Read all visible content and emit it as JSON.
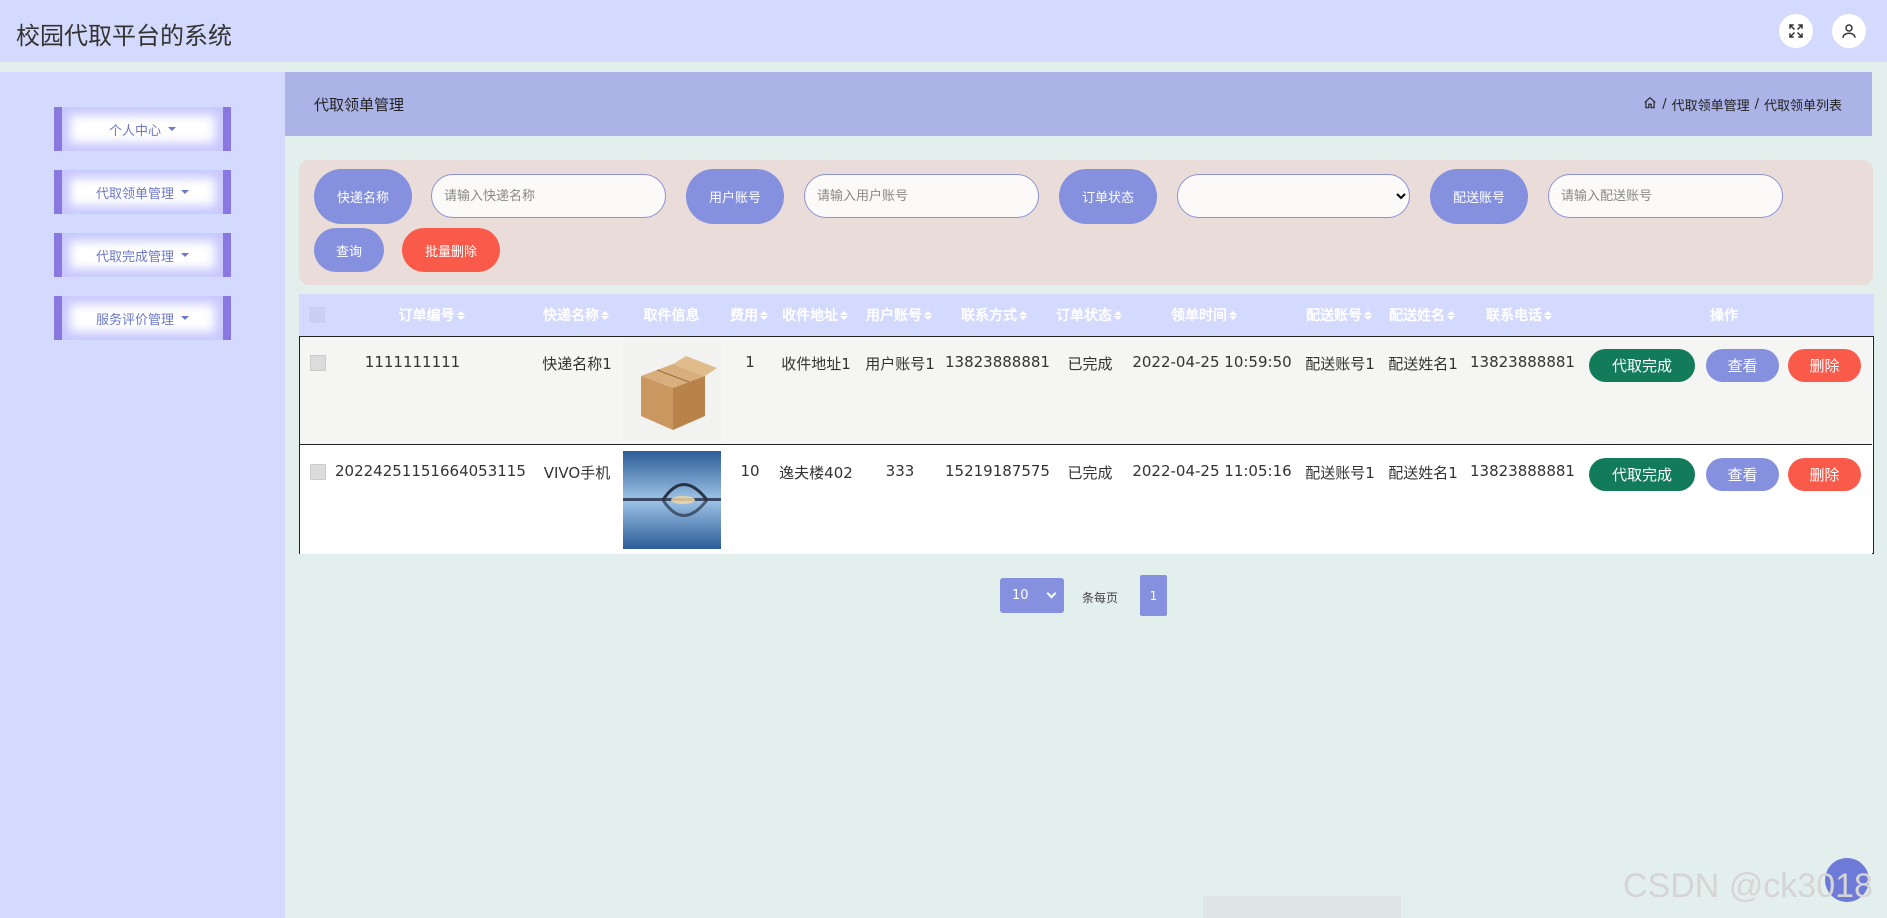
{
  "app": {
    "title": "校园代取平台的系统"
  },
  "header_icons": {
    "fullscreen": "fullscreen-icon",
    "user": "user-icon"
  },
  "sidebar": {
    "items": [
      {
        "label": "个人中心"
      },
      {
        "label": "代取领单管理"
      },
      {
        "label": "代取完成管理"
      },
      {
        "label": "服务评价管理"
      }
    ]
  },
  "content_header": {
    "title": "代取领单管理",
    "breadcrumb": [
      "代取领单管理",
      "代取领单列表"
    ],
    "breadcrumb_sep": "/"
  },
  "search": {
    "express_name_label": "快递名称",
    "express_name_placeholder": "请输入快递名称",
    "user_account_label": "用户账号",
    "user_account_placeholder": "请输入用户账号",
    "order_status_label": "订单状态",
    "order_status_value": "",
    "delivery_account_label": "配送账号",
    "delivery_account_placeholder": "请输入配送账号",
    "query_button": "查询",
    "batch_delete_button": "批量删除"
  },
  "table": {
    "columns": [
      "订单编号",
      "快递名称",
      "取件信息",
      "费用",
      "收件地址",
      "用户账号",
      "联系方式",
      "订单状态",
      "领单时间",
      "配送账号",
      "配送姓名",
      "联系电话",
      "操作"
    ],
    "rows": [
      {
        "order_no": "1111111111",
        "express_name": "快递名称1",
        "pickup_image": "cardboard-box-photo",
        "fee": "1",
        "address": "收件地址1",
        "user_account": "用户账号1",
        "contact": "13823888881",
        "status": "已完成",
        "time": "2022-04-25 10:59:50",
        "delivery_account": "配送账号1",
        "delivery_name": "配送姓名1",
        "phone": "13823888881"
      },
      {
        "order_no": "20224251151664053115",
        "express_name": "VIVO手机",
        "pickup_image": "bridge-reflection-photo",
        "fee": "10",
        "address": "逸夫楼402",
        "user_account": "333",
        "contact": "15219187575",
        "status": "已完成",
        "time": "2022-04-25 11:05:16",
        "delivery_account": "配送账号1",
        "delivery_name": "配送姓名1",
        "phone": "13823888881"
      }
    ],
    "actions": {
      "complete": "代取完成",
      "view": "查看",
      "delete": "删除"
    }
  },
  "pagination": {
    "page_size": "10",
    "per_page_label": "条每页",
    "current_page": "1"
  },
  "watermark": "CSDN @ck3018",
  "colors": {
    "topbar": "#d4dafe",
    "header": "#abb3e7",
    "accent": "#8591de",
    "danger": "#fa5a4a",
    "success": "#127b5a"
  }
}
